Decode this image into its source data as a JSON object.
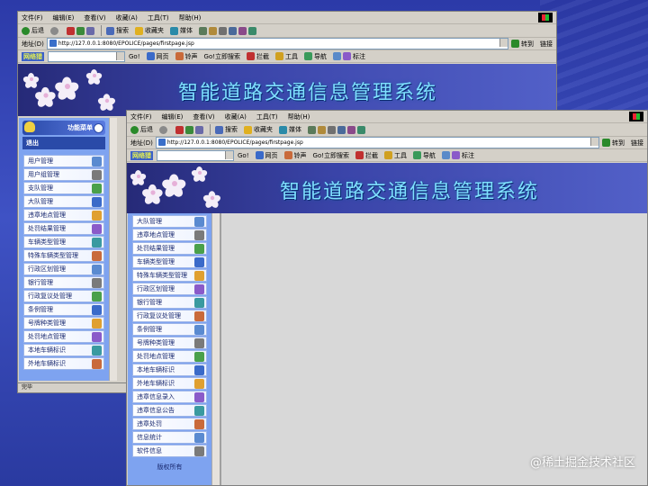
{
  "browser": {
    "menu": [
      "文件(F)",
      "编辑(E)",
      "查看(V)",
      "收藏(A)",
      "工具(T)",
      "帮助(H)"
    ],
    "toolbar": {
      "back": "后退",
      "search": "搜索",
      "favorites": "收藏夹",
      "media": "媒体"
    },
    "address_label": "地址(D)",
    "url": "http://127.0.0.1:8080/EPOLICE/pages/firstpage.jsp",
    "go_label": "转到",
    "links_label": "链接",
    "links_bar": {
      "brand": "网络猎",
      "go": "Go!",
      "web": "网页",
      "ring": "铃声",
      "instant": "Go!立即搜索",
      "block": "拦截",
      "tools": "工具",
      "nav": "导航",
      "mark": "标注"
    }
  },
  "app": {
    "title": "智能道路交通信息管理系统",
    "sidebar_header": "功能菜单",
    "logout": "退出",
    "copyright": "版权所有",
    "status": "完毕"
  },
  "menu_back": [
    "用户管理",
    "用户组管理",
    "支队管理",
    "大队管理",
    "违章地点管理",
    "处罚结果管理",
    "车辆类型管理",
    "特殊车辆类型管理",
    "行政区划管理",
    "银行管理",
    "行政复议处管理",
    "条例管理",
    "号牌种类管理",
    "处罚地点管理",
    "本地车辆标识",
    "外地车辆标识"
  ],
  "menu_front": [
    "大队管理",
    "违章地点管理",
    "处罚结果管理",
    "车辆类型管理",
    "特殊车辆类型管理",
    "行政区划管理",
    "银行管理",
    "行政复议处管理",
    "条例管理",
    "号牌种类管理",
    "处罚地点管理",
    "本地车辆标识",
    "外地车辆标识",
    "违章信息录入",
    "违章信息公告",
    "违章处罚",
    "信息统计",
    "软件信息"
  ],
  "watermark": "@稀土掘金技术社区",
  "colors": {
    "banner_title": "#7fe0ff",
    "sidebar": "#7ea3f0",
    "item_text": "#1a2a70",
    "desktop": "#3f52c4"
  }
}
